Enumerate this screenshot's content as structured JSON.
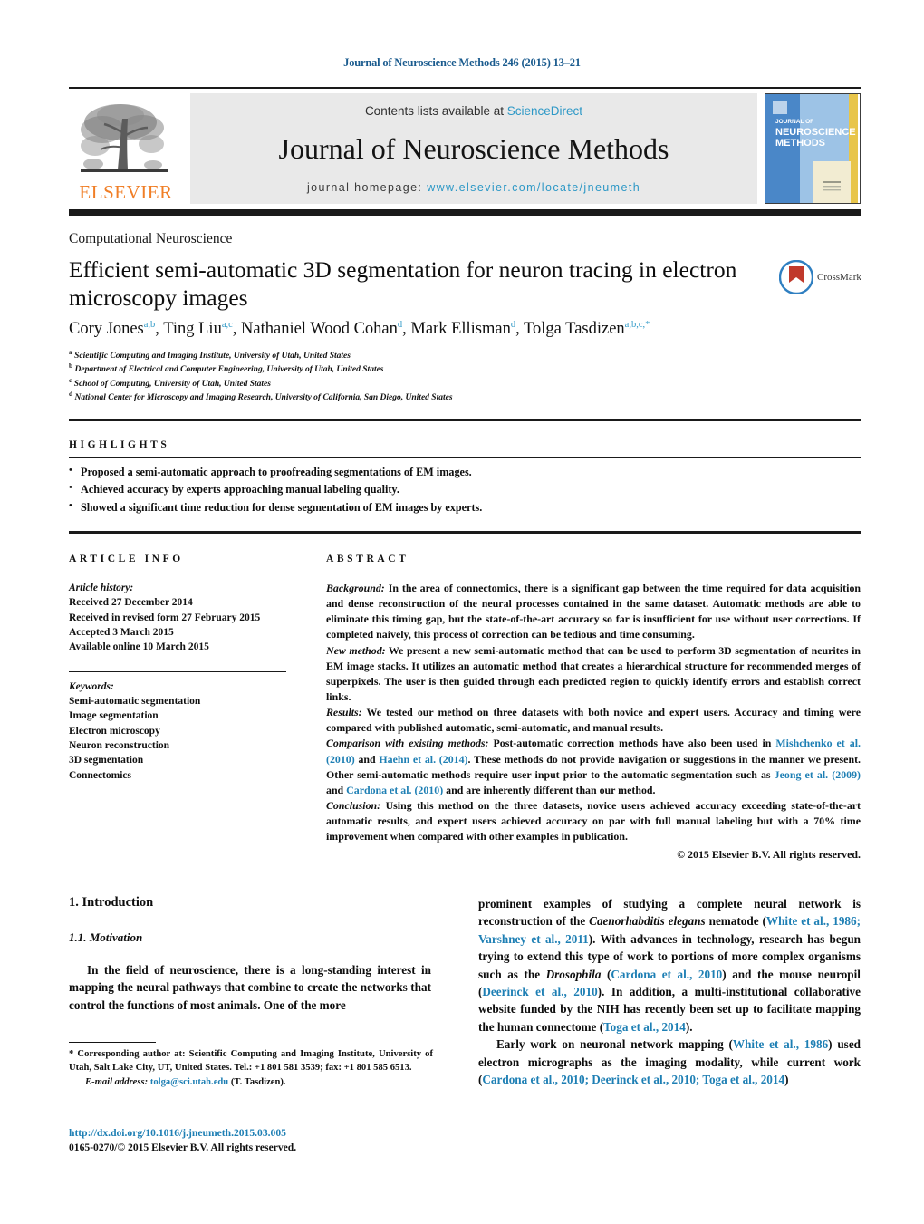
{
  "running_head": "Journal of Neuroscience Methods 246 (2015) 13–21",
  "masthead": {
    "contents_prefix": "Contents lists available at ",
    "contents_link": "ScienceDirect",
    "journal_title": "Journal of Neuroscience Methods",
    "homepage_prefix": "journal homepage:",
    "homepage_url": "www.elsevier.com/locate/jneumeth",
    "publisher_wordmark": "ELSEVIER",
    "cover_line1": "JOURNAL OF",
    "cover_line2": "NEUROSCIENCE",
    "cover_line3": "METHODS",
    "link_color": "#2d98c6",
    "wordmark_color": "#f07e26"
  },
  "article": {
    "section_label": "Computational Neuroscience",
    "title": "Efficient semi-automatic 3D segmentation for neuron tracing in electron microscopy images",
    "crossmark_label": "CrossMark",
    "authors": [
      {
        "name": "Cory Jones",
        "marks": "a,b",
        "sep": ", "
      },
      {
        "name": "Ting Liu",
        "marks": "a,c",
        "sep": ", "
      },
      {
        "name": "Nathaniel Wood Cohan",
        "marks": "d",
        "sep": ", "
      },
      {
        "name": "Mark Ellisman",
        "marks": "d",
        "sep": ", "
      },
      {
        "name": "Tolga Tasdizen",
        "marks": "a,b,c,*",
        "sep": ""
      }
    ],
    "affiliations": [
      {
        "mark": "a",
        "text": "Scientific Computing and Imaging Institute, University of Utah, United States"
      },
      {
        "mark": "b",
        "text": "Department of Electrical and Computer Engineering, University of Utah, United States"
      },
      {
        "mark": "c",
        "text": "School of Computing, University of Utah, United States"
      },
      {
        "mark": "d",
        "text": "National Center for Microscopy and Imaging Research, University of California, San Diego, United States"
      }
    ]
  },
  "highlights": {
    "heading": "HIGHLIGHTS",
    "items": [
      "Proposed a semi-automatic approach to proofreading segmentations of EM images.",
      "Achieved accuracy by experts approaching manual labeling quality.",
      "Showed a significant time reduction for dense segmentation of EM images by experts."
    ]
  },
  "article_info": {
    "heading": "ARTICLE INFO",
    "history_label": "Article history:",
    "history": [
      "Received 27 December 2014",
      "Received in revised form 27 February 2015",
      "Accepted 3 March 2015",
      "Available online 10 March 2015"
    ],
    "keywords_label": "Keywords:",
    "keywords": [
      "Semi-automatic segmentation",
      "Image segmentation",
      "Electron microscopy",
      "Neuron reconstruction",
      "3D segmentation",
      "Connectomics"
    ]
  },
  "abstract": {
    "heading": "ABSTRACT",
    "background_label": "Background:",
    "background_text": " In the area of connectomics, there is a significant gap between the time required for data acquisition and dense reconstruction of the neural processes contained in the same dataset. Automatic methods are able to eliminate this timing gap, but the state-of-the-art accuracy so far is insufficient for use without user corrections. If completed naively, this process of correction can be tedious and time consuming.",
    "newmethod_label": "New method:",
    "newmethod_text": " We present a new semi-automatic method that can be used to perform 3D segmentation of neurites in EM image stacks. It utilizes an automatic method that creates a hierarchical structure for recommended merges of superpixels. The user is then guided through each predicted region to quickly identify errors and establish correct links.",
    "results_label": "Results:",
    "results_text": " We tested our method on three datasets with both novice and expert users. Accuracy and timing were compared with published automatic, semi-automatic, and manual results.",
    "comparison_label": "Comparison with existing methods:",
    "comparison_part1": " Post-automatic correction methods have also been used in ",
    "comparison_cite1": "Mishchenko et al. (2010)",
    "comparison_part2": " and ",
    "comparison_cite2": "Haehn et al. (2014)",
    "comparison_part3": ". These methods do not provide navigation or suggestions in the manner we present. Other semi-automatic methods require user input prior to the automatic segmentation such as ",
    "comparison_cite3": "Jeong et al. (2009)",
    "comparison_part4": " and ",
    "comparison_cite4": "Cardona et al. (2010)",
    "comparison_part5": " and are inherently different than our method.",
    "conclusion_label": "Conclusion:",
    "conclusion_text": " Using this method on the three datasets, novice users achieved accuracy exceeding state-of-the-art automatic results, and expert users achieved accuracy on par with full manual labeling but with a 70% time improvement when compared with other examples in publication.",
    "copyright": "© 2015 Elsevier B.V. All rights reserved."
  },
  "body": {
    "h1": "1.  Introduction",
    "h2": "1.1.  Motivation",
    "left_para1": "In the field of neuroscience, there is a long-standing interest in mapping the neural pathways that combine to create the networks that control the functions of most animals. One of the more",
    "right_para1_a": "prominent examples of studying a complete neural network is reconstruction of the ",
    "right_para1_italic": "Caenorhabditis elegans",
    "right_para1_b": " nematode (",
    "right_para1_cite1": "White et al., 1986; Varshney et al., 2011",
    "right_para1_c": "). With advances in technology, research has begun trying to extend this type of work to portions of more complex organisms such as the ",
    "right_para1_italic2": "Drosophila",
    "right_para1_d": " (",
    "right_para1_cite2": "Cardona et al., 2010",
    "right_para1_e": ") and the mouse neuropil (",
    "right_para1_cite3": "Deerinck et al., 2010",
    "right_para1_f": "). In addition, a multi-institutional collaborative website funded by the NIH has recently been set up to facilitate mapping the human connectome (",
    "right_para1_cite4": "Toga et al., 2014",
    "right_para1_g": ").",
    "right_para2_a": "Early work on neuronal network mapping (",
    "right_para2_cite1": "White et al., 1986",
    "right_para2_b": ") used electron micrographs as the imaging modality, while current work (",
    "right_para2_cite2": "Cardona et al., 2010; Deerinck et al., 2010; Toga et al., 2014",
    "right_para2_c": ")"
  },
  "footnotes": {
    "corresponding": "* Corresponding author at: Scientific Computing and Imaging Institute, University of Utah, Salt Lake City, UT, United States. Tel.: +1 801 581 3539; fax: +1 801 585 6513.",
    "email_label": "E-mail address:",
    "email": "tolga@sci.utah.edu",
    "email_owner": " (T. Tasdizen).",
    "doi": "http://dx.doi.org/10.1016/j.jneumeth.2015.03.005",
    "issn": "0165-0270/© 2015 Elsevier B.V. All rights reserved."
  }
}
